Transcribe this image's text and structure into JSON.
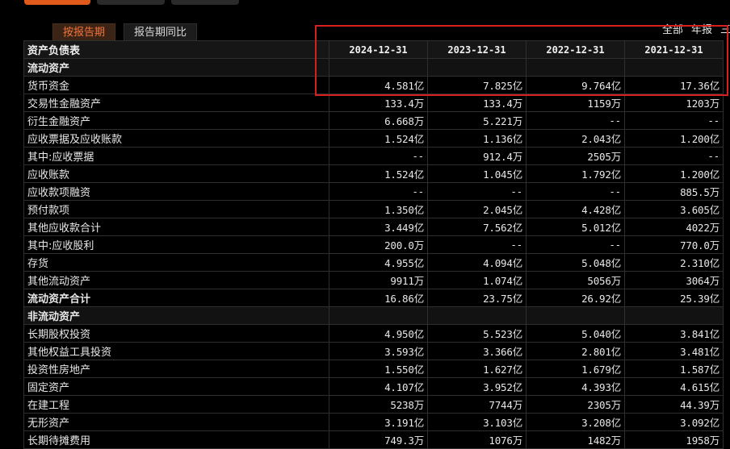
{
  "tabs": [
    {
      "label": "按报告期",
      "active": true
    },
    {
      "label": "报告期同比",
      "active": false
    }
  ],
  "filters": [
    "全部",
    "年报",
    "三季"
  ],
  "table": {
    "header": {
      "title": "资产负债表",
      "dates": [
        "2024-12-31",
        "2023-12-31",
        "2022-12-31",
        "2021-12-31"
      ]
    },
    "rows": [
      {
        "type": "section",
        "label": "流动资产",
        "values": [
          "",
          "",
          "",
          ""
        ]
      },
      {
        "type": "item",
        "indent": 1,
        "label": "货币资金",
        "values": [
          "4.581亿",
          "7.825亿",
          "9.764亿",
          "17.36亿"
        ]
      },
      {
        "type": "item",
        "indent": 1,
        "label": "交易性金融资产",
        "values": [
          "133.4万",
          "133.4万",
          "1159万",
          "1203万"
        ]
      },
      {
        "type": "item",
        "indent": 1,
        "label": "衍生金融资产",
        "values": [
          "6.668万",
          "5.221万",
          "--",
          "--"
        ]
      },
      {
        "type": "item",
        "indent": 1,
        "label": "应收票据及应收账款",
        "values": [
          "1.524亿",
          "1.136亿",
          "2.043亿",
          "1.200亿"
        ]
      },
      {
        "type": "item",
        "indent": 1,
        "label": "其中:应收票据",
        "values": [
          "--",
          "912.4万",
          "2505万",
          "--"
        ]
      },
      {
        "type": "item",
        "indent": 2,
        "label": "应收账款",
        "values": [
          "1.524亿",
          "1.045亿",
          "1.792亿",
          "1.200亿"
        ]
      },
      {
        "type": "item",
        "indent": 1,
        "label": "应收款项融资",
        "values": [
          "--",
          "--",
          "--",
          "885.5万"
        ]
      },
      {
        "type": "item",
        "indent": 1,
        "label": "预付款项",
        "values": [
          "1.350亿",
          "2.045亿",
          "4.428亿",
          "3.605亿"
        ]
      },
      {
        "type": "item",
        "indent": 1,
        "label": "其他应收款合计",
        "values": [
          "3.449亿",
          "7.562亿",
          "5.012亿",
          "4022万"
        ]
      },
      {
        "type": "item",
        "indent": 1,
        "label": "其中:应收股利",
        "values": [
          "200.0万",
          "--",
          "--",
          "770.0万"
        ]
      },
      {
        "type": "item",
        "indent": 1,
        "label": "存货",
        "values": [
          "4.955亿",
          "4.094亿",
          "5.048亿",
          "2.310亿"
        ]
      },
      {
        "type": "item",
        "indent": 1,
        "label": "其他流动资产",
        "values": [
          "9911万",
          "1.074亿",
          "5056万",
          "3064万"
        ]
      },
      {
        "type": "total",
        "indent": 0,
        "label": "流动资产合计",
        "values": [
          "16.86亿",
          "23.75亿",
          "26.92亿",
          "25.39亿"
        ]
      },
      {
        "type": "section",
        "label": "非流动资产",
        "values": [
          "",
          "",
          "",
          ""
        ]
      },
      {
        "type": "item",
        "indent": 1,
        "label": "长期股权投资",
        "values": [
          "4.950亿",
          "5.523亿",
          "5.040亿",
          "3.841亿"
        ]
      },
      {
        "type": "item",
        "indent": 1,
        "label": "其他权益工具投资",
        "values": [
          "3.593亿",
          "3.366亿",
          "2.801亿",
          "3.481亿"
        ]
      },
      {
        "type": "item",
        "indent": 1,
        "label": "投资性房地产",
        "values": [
          "1.550亿",
          "1.627亿",
          "1.679亿",
          "1.587亿"
        ]
      },
      {
        "type": "item",
        "indent": 1,
        "label": "固定资产",
        "values": [
          "4.107亿",
          "3.952亿",
          "4.393亿",
          "4.615亿"
        ]
      },
      {
        "type": "item",
        "indent": 1,
        "label": "在建工程",
        "values": [
          "5238万",
          "7744万",
          "2305万",
          "44.39万"
        ]
      },
      {
        "type": "item",
        "indent": 1,
        "label": "无形资产",
        "values": [
          "3.191亿",
          "3.103亿",
          "3.208亿",
          "3.092亿"
        ]
      },
      {
        "type": "item",
        "indent": 1,
        "label": "长期待摊费用",
        "values": [
          "749.3万",
          "1076万",
          "1482万",
          "1958万"
        ]
      }
    ]
  },
  "colors": {
    "active_tab_text": "#f3743a",
    "highlight_border": "#d62020",
    "background": "#000000"
  }
}
